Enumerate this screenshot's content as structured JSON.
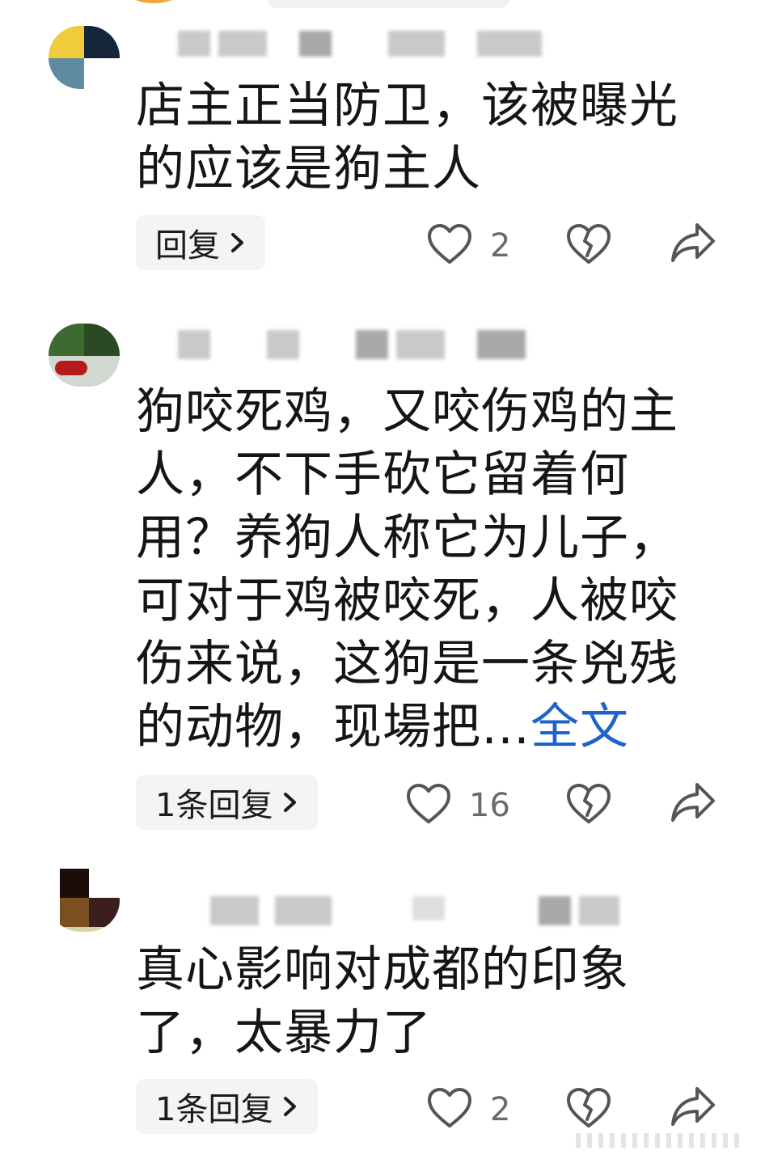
{
  "comments": [
    {
      "text": "店主正当防卫，该被曝光的应该是狗主人",
      "text_lines": [
        "店主正当防卫，该被曝光",
        "的应该是狗主人"
      ],
      "reply_label": "回复",
      "likes": "2",
      "avatar_icon": "user-avatar",
      "colors": [
        "#f0cc3c",
        "#15253a",
        "#5f8aa0",
        "#ffffff"
      ]
    },
    {
      "text_lines": [
        "狗咬死鸡，又咬伤鸡的主",
        "人，不下手砍它留着何",
        "用？养狗人称它为儿子，",
        "可对于鸡被咬死，人被咬",
        "伤来说，这狗是一条兇残",
        "的动物，现場把…"
      ],
      "more_label": "全文",
      "reply_label": "1条回复",
      "likes": "16",
      "avatar_icon": "user-avatar",
      "colors": [
        "#3d6a2f",
        "#2b4a23",
        "#d0d8d2",
        "#b51b1b"
      ]
    },
    {
      "text_lines": [
        "真心影响对成都的印象",
        "了，太暴力了"
      ],
      "reply_label": "1条回复",
      "likes": "2",
      "avatar_icon": "user-avatar",
      "colors": [
        "#1b0d0a",
        "#7a5020",
        "#3a1f1a",
        "#d7d2a8"
      ]
    }
  ],
  "icons": {
    "like": "heart-outline-icon",
    "dislike": "broken-heart-icon",
    "share": "share-arrow-icon",
    "chevron": "chevron-right-icon"
  },
  "accent": "#1e63c8"
}
